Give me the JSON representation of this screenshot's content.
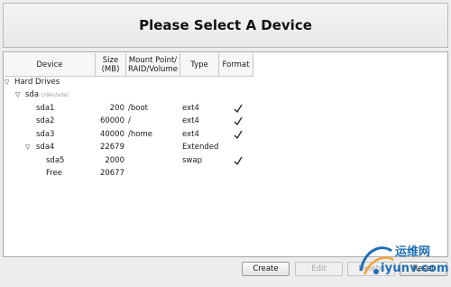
{
  "header": {
    "title": "Please Select A Device"
  },
  "columns": {
    "device": "Device",
    "size_line1": "Size",
    "size_line2": "(MB)",
    "mount_line1": "Mount Point/",
    "mount_line2": "RAID/Volume",
    "type": "Type",
    "format": "Format"
  },
  "tree": {
    "hard_drives": "Hard Drives",
    "sda": {
      "name": "sda",
      "path": "(/dev/sda)"
    },
    "rows": [
      {
        "device": "sda1",
        "size": "200",
        "mount": "/boot",
        "type": "ext4",
        "format": true
      },
      {
        "device": "sda2",
        "size": "60000",
        "mount": "/",
        "type": "ext4",
        "format": true
      },
      {
        "device": "sda3",
        "size": "40000",
        "mount": "/home",
        "type": "ext4",
        "format": true
      },
      {
        "device": "sda4",
        "size": "22679",
        "mount": "",
        "type": "Extended",
        "format": false
      },
      {
        "device": "sda5",
        "size": "2000",
        "mount": "",
        "type": "swap",
        "format": true
      },
      {
        "device": "Free",
        "size": "20677",
        "mount": "",
        "type": "",
        "format": false
      }
    ]
  },
  "buttons": {
    "create": "Create",
    "edit": "Edit",
    "delete": "Delete",
    "reset": "Reset"
  },
  "watermark": {
    "cn": "运维网",
    "latin": "iyunv.com"
  },
  "colors": {
    "watermark_blue": "#1f6fb5",
    "watermark_orange": "#f0a030"
  }
}
